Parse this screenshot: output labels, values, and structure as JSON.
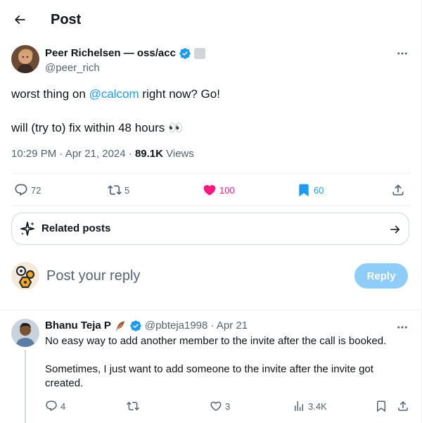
{
  "header": {
    "title": "Post"
  },
  "post": {
    "author_name": "Peer Richelsen — oss/acc",
    "author_handle": "@peer_rich",
    "text_before_mention": "worst thing on ",
    "mention": "@calcom",
    "text_after_mention": " right now? Go!",
    "line2": "will (try to) fix within 48 hours 👀",
    "time": "10:29 PM · Apr 21, 2024 · ",
    "views_count": "89.1K",
    "views_label": " Views",
    "stats": {
      "replies": "72",
      "reposts": "5",
      "likes": "100",
      "bookmarks": "60"
    },
    "colors": {
      "like": "#f91880",
      "bookmark": "#1d9bf0",
      "mention": "#1d9bf0"
    }
  },
  "related": {
    "label": "Related posts"
  },
  "composer": {
    "placeholder": "Post your reply",
    "button": "Reply"
  },
  "reply": {
    "name": "Bhanu Teja P",
    "handle_date": "@pbteja1998 · Apr 21",
    "para1": "No easy way to add another member to the invite after the call is booked.",
    "para2": "Sometimes, I just want to add someone to the invite after the invite got created.",
    "stats": {
      "replies": "4",
      "reposts": "",
      "likes": "3",
      "views": "3.4K"
    }
  }
}
